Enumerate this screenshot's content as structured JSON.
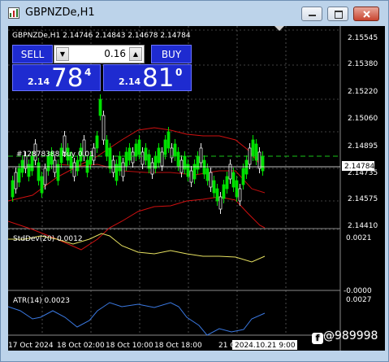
{
  "window": {
    "title": "GBPNZDe,H1",
    "icon": "chart-window-icon",
    "buttons": [
      "minimize-icon",
      "restore-icon",
      "close-icon"
    ]
  },
  "chart": {
    "header": "GBPNZDe,H1  2.14746 2.14843 2.14678 2.14784",
    "order_label": "#12878388 buy 0.01",
    "current_price": "2.14784",
    "price_axis": [
      "2.15545",
      "2.15380",
      "2.15220",
      "2.15060",
      "2.14895",
      "2.14735",
      "2.14575",
      "2.14410"
    ],
    "time_axis": [
      "17 Oct 2024",
      "18 Oct 02:00",
      "18 Oct 10:00",
      "18 Oct 18:00",
      "21 Oc"
    ],
    "time_cursor": "2024.10.21 9:00",
    "stddev": {
      "label": "StdDev(20) 0.0012",
      "axis": [
        "0.0021",
        "-0.0000"
      ]
    },
    "atr": {
      "label": "ATR(14) 0.0023",
      "axis": [
        "0.0027"
      ]
    },
    "colors": {
      "bull": "#00e000",
      "bear": "#e8e8e8",
      "bands": "#d01010",
      "stddev": "#e6e060",
      "atr": "#3a78e0",
      "grid": "#808080"
    }
  },
  "trade_panel": {
    "sell_label": "SELL",
    "buy_label": "BUY",
    "lot": "0.16",
    "sell_prefix": "2.14",
    "sell_big": "78",
    "sell_sup": "4",
    "buy_prefix": "2.14",
    "buy_big": "81",
    "buy_sup": "0"
  },
  "watermark": "@989998"
}
